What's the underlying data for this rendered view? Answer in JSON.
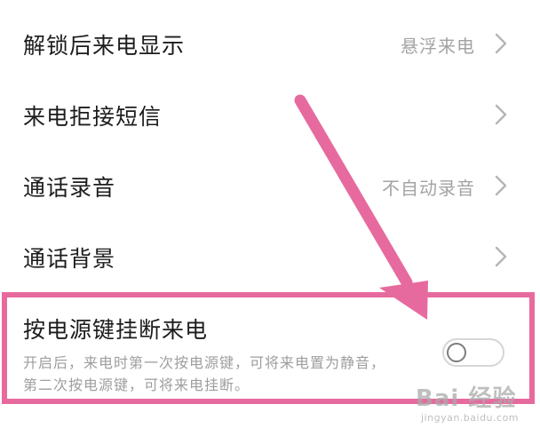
{
  "settings": {
    "rows": [
      {
        "label": "解锁后来电显示",
        "value": "悬浮来电"
      },
      {
        "label": "来电拒接短信",
        "value": ""
      },
      {
        "label": "通话录音",
        "value": "不自动录音"
      },
      {
        "label": "通话背景",
        "value": ""
      }
    ],
    "power_key": {
      "title": "按电源键挂断来电",
      "description": "开启后，来电时第一次按电源键，可将来电置为静音，第二次按电源键，可将来电挂断。",
      "enabled": false
    }
  },
  "annotation": {
    "color": "#e76a9e"
  },
  "watermark": {
    "brand": "Bai 经验",
    "url": "jingyan.baidu.com"
  }
}
